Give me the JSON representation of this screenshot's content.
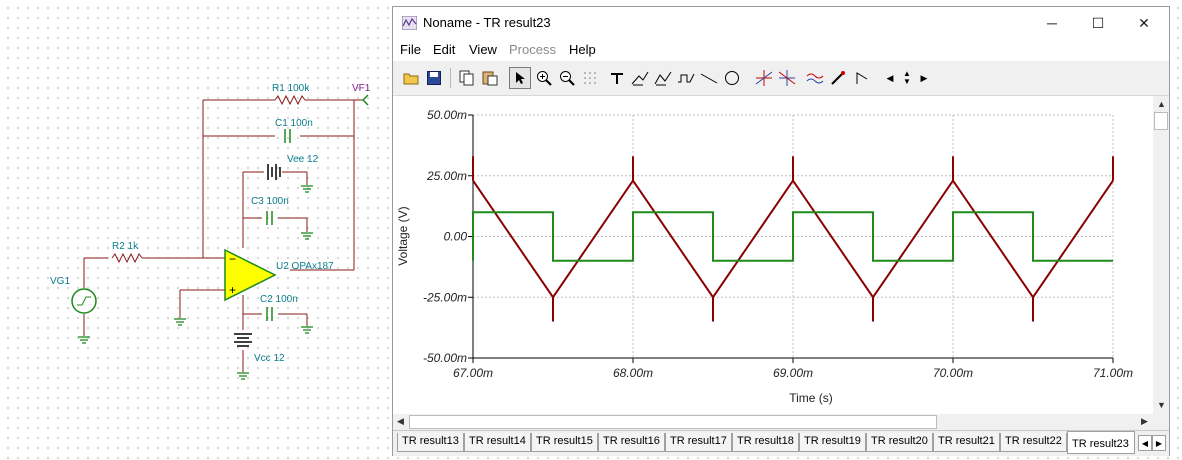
{
  "schematic": {
    "components": [
      {
        "id": "R1",
        "label": "R1 100k"
      },
      {
        "id": "C1",
        "label": "C1 100n"
      },
      {
        "id": "VF1",
        "label": "VF1"
      },
      {
        "id": "Vee",
        "label": "Vee 12"
      },
      {
        "id": "C3",
        "label": "C3 100n"
      },
      {
        "id": "R2",
        "label": "R2 1k"
      },
      {
        "id": "U2",
        "label": "U2 OPAx187"
      },
      {
        "id": "VG1",
        "label": "VG1"
      },
      {
        "id": "C2",
        "label": "C2 100n"
      },
      {
        "id": "Vcc",
        "label": "Vcc 12"
      }
    ],
    "opamp_color": "#ffff00",
    "wire_color": "#8b1a1a",
    "pin_color": "#00aa00"
  },
  "window": {
    "title": "Noname - TR result23",
    "icon": "chart-window-icon",
    "controls": {
      "minimize": "─",
      "maximize": "☐",
      "close": "✕"
    }
  },
  "menu": [
    {
      "label": "File",
      "enabled": true
    },
    {
      "label": "Edit",
      "enabled": true
    },
    {
      "label": "View",
      "enabled": true
    },
    {
      "label": "Process",
      "enabled": false
    },
    {
      "label": "Help",
      "enabled": true
    }
  ],
  "toolbar": {
    "icons": [
      "open-folder-icon",
      "save-icon",
      "copy-icon",
      "paste-icon",
      "select-arrow-icon",
      "zoom-in-icon",
      "zoom-100-icon",
      "grid-icon",
      "text-tool-icon",
      "cursor-a-icon",
      "cursor-b-icon",
      "fft-icon",
      "line-tool-icon",
      "circle-tool-icon",
      "cross-cursor-a-icon",
      "cross-cursor-b-icon",
      "curve-icon",
      "probe-icon",
      "marker-icon",
      "arrow-left-icon",
      "arrow-updown-icon",
      "arrow-right-icon"
    ]
  },
  "chart_data": {
    "type": "line",
    "xlabel": "Time (s)",
    "ylabel": "Voltage (V)",
    "xlim": [
      67.0,
      71.0
    ],
    "ylim": [
      -50,
      50
    ],
    "x_ticks": [
      "67.00m",
      "68.00m",
      "69.00m",
      "70.00m",
      "71.00m"
    ],
    "y_ticks": [
      "50.00m",
      "25.00m",
      "0.00",
      "-25.00m",
      "-50.00m"
    ],
    "grid": true,
    "series": [
      {
        "color": "#8b0000",
        "x": [
          67.0,
          67.5,
          68.0,
          68.5,
          69.0,
          69.5,
          70.0,
          70.5,
          71.0
        ],
        "y": [
          23,
          -25,
          23,
          -25,
          23,
          -25,
          23,
          -25,
          23
        ]
      },
      {
        "color": "#1e8a1e",
        "x": [
          67.0,
          67.0,
          67.5,
          67.5,
          68.0,
          68.0,
          68.5,
          68.5,
          69.0,
          69.0,
          69.5,
          69.5,
          70.0,
          70.0,
          70.5,
          70.5,
          71.0,
          71.0
        ],
        "y": [
          -10,
          10,
          10,
          -10,
          -10,
          10,
          10,
          -10,
          -10,
          10,
          10,
          -10,
          -10,
          10,
          10,
          -10,
          -10,
          -10
        ]
      }
    ],
    "spike_markers": {
      "x": [
        67.0,
        67.5,
        68.0,
        68.5,
        69.0,
        69.5,
        70.0,
        70.5,
        71.0
      ],
      "top": [
        33,
        -35,
        33,
        -35,
        33,
        -35,
        33,
        -35,
        33
      ]
    }
  },
  "tabs": {
    "items": [
      "TR result13",
      "TR result14",
      "TR result15",
      "TR result16",
      "TR result17",
      "TR result18",
      "TR result19",
      "TR result20",
      "TR result21",
      "TR result22",
      "TR result23"
    ],
    "active": "TR result23"
  }
}
